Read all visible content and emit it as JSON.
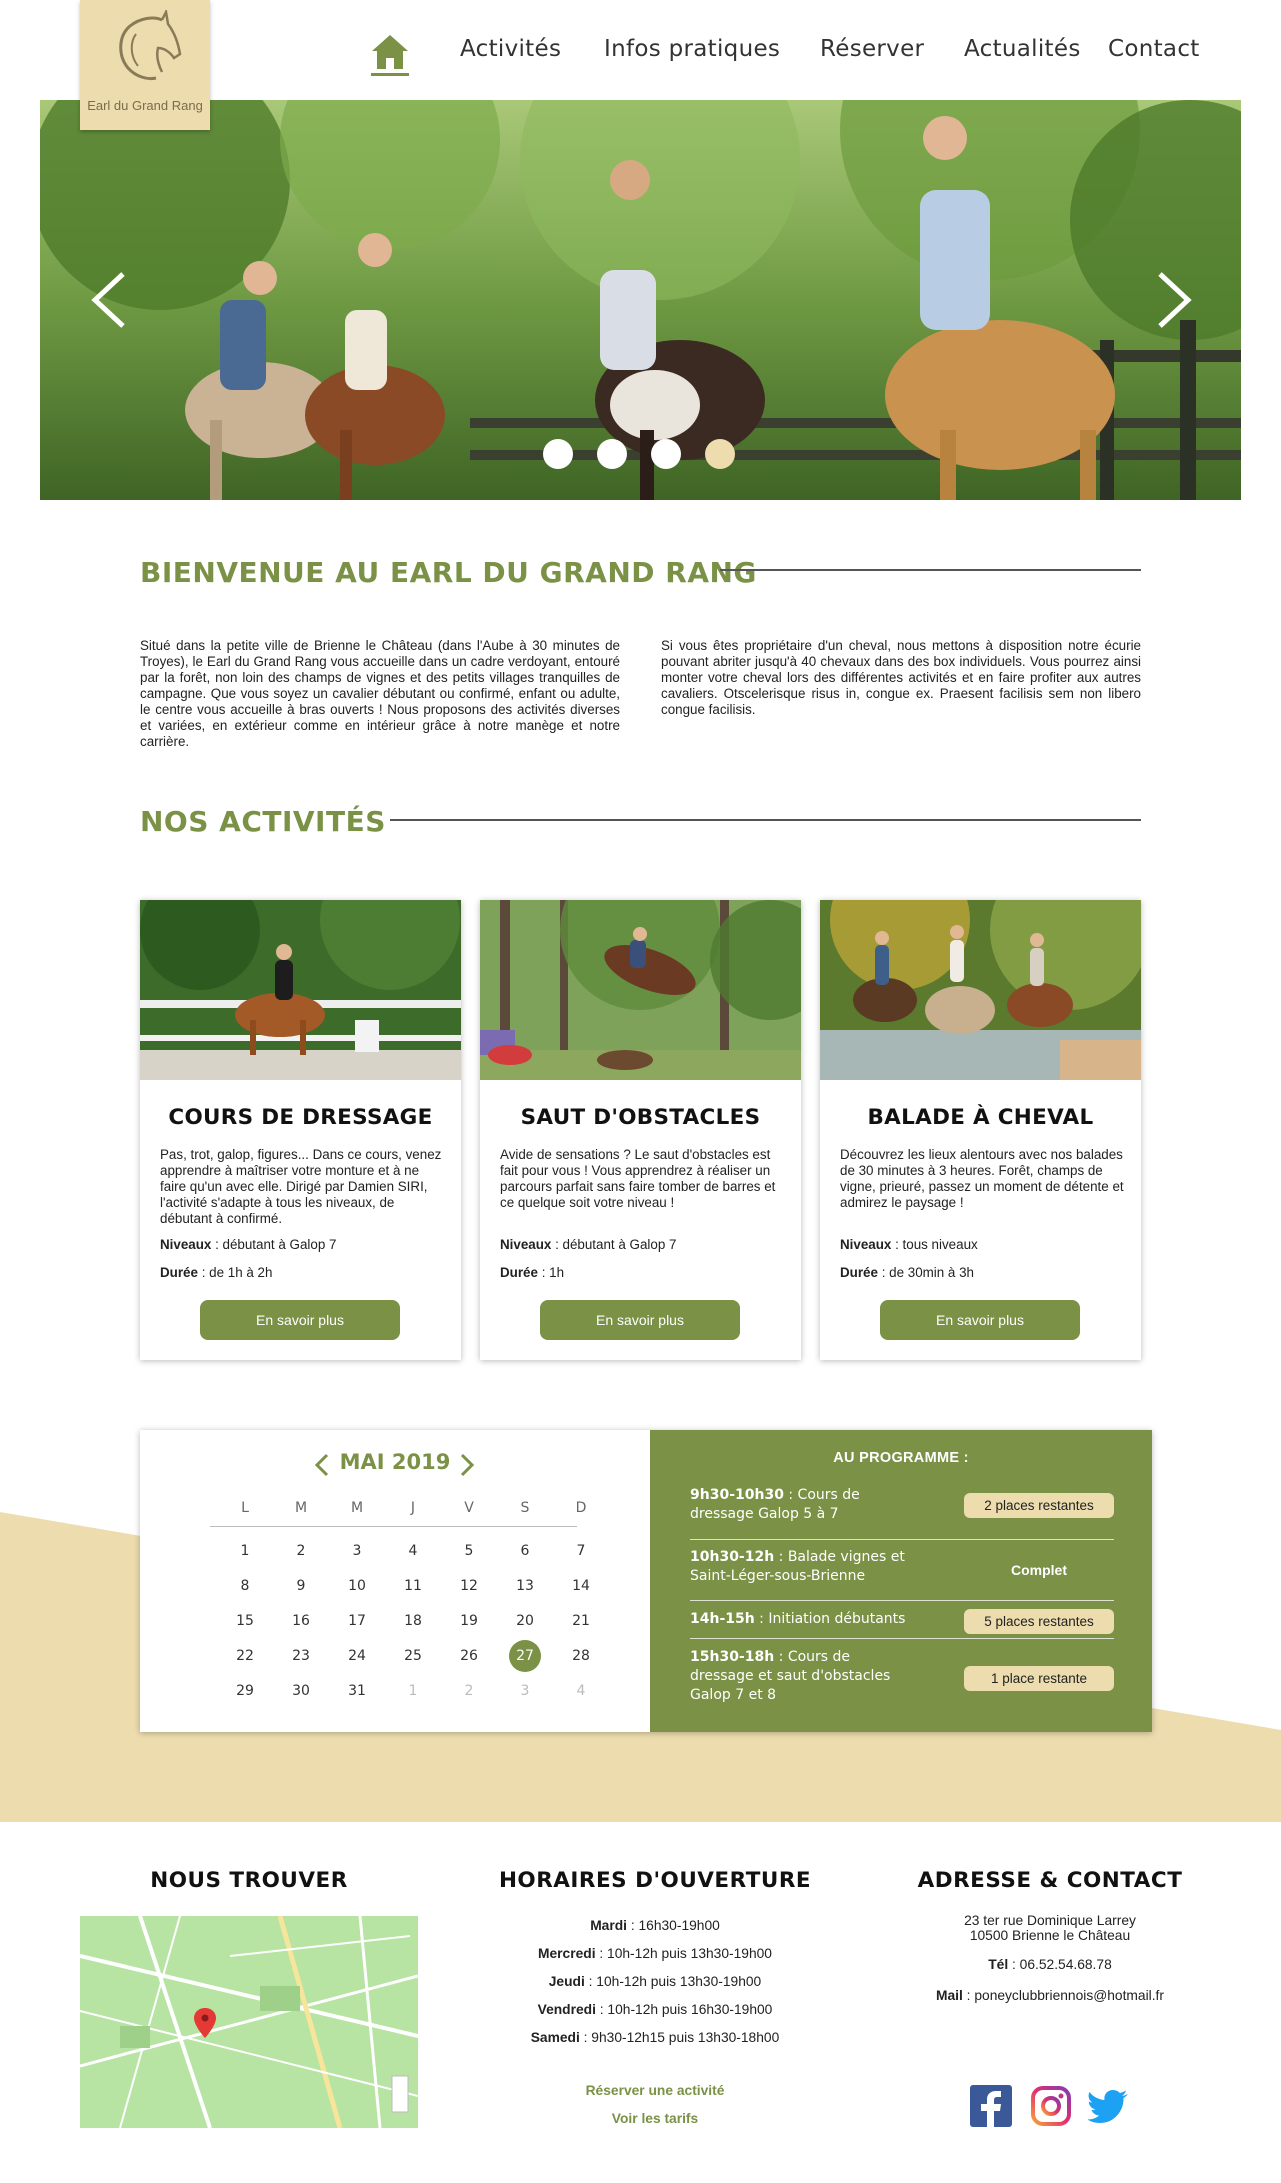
{
  "brand": {
    "logo_text": "Earl du Grand Rang"
  },
  "nav": {
    "home_icon": "home-icon",
    "items": [
      "Activités",
      "Infos pratiques",
      "Réserver",
      "Actualités",
      "Contact"
    ]
  },
  "slider": {
    "prev_icon": "chevron-left-icon",
    "next_icon": "chevron-right-icon",
    "slide_count": 4,
    "active_slide": 4
  },
  "welcome": {
    "title": "BIENVENUE AU EARL DU GRAND RANG",
    "col1": "Situé dans la petite ville de Brienne le Château (dans l'Aube à 30 minutes de Troyes), le Earl du Grand Rang vous accueille dans un cadre verdoyant, entouré par la forêt, non loin des champs de vignes et des petits villages tranquilles de campagne. Que vous soyez un cavalier débutant ou confirmé, enfant ou adulte, le centre vous accueille à bras ouverts ! Nous proposons des activités diverses et variées, en extérieur comme en intérieur grâce à notre manège et notre carrière.",
    "col2": "Si vous êtes propriétaire d'un cheval, nous mettons à disposition notre écurie pouvant abriter jusqu'à 40 chevaux dans des box individuels. Vous pourrez ainsi monter votre cheval lors des différentes activités et en faire profiter aux autres cavaliers. Otscelerisque risus in, congue ex. Praesent facilisis sem non libero congue facilisis."
  },
  "activities": {
    "title": "NOS ACTIVITÉS",
    "cards": [
      {
        "title": "COURS DE DRESSAGE",
        "description": "Pas, trot, galop, figures... Dans ce cours, venez apprendre à maîtriser votre monture et à ne faire qu'un avec elle. Dirigé par Damien SIRI, l'activité s'adapte à tous les niveaux, de débutant à confirmé.",
        "level_label": "Niveaux",
        "level": " : débutant à Galop 7",
        "duration_label": "Durée",
        "duration": " : de 1h à 2h",
        "button": "En savoir plus"
      },
      {
        "title": "SAUT D'OBSTACLES",
        "description": "Avide de sensations ? Le saut d'obstacles est fait pour vous ! Vous apprendrez à réaliser un parcours parfait sans faire tomber de barres et ce quelque soit votre niveau !",
        "level_label": "Niveaux",
        "level": " : débutant à Galop 7",
        "duration_label": "Durée",
        "duration": " : 1h",
        "button": "En savoir plus"
      },
      {
        "title": "BALADE À CHEVAL",
        "description": "Découvrez les lieux alentours avec nos balades de 30 minutes à 3 heures. Forêt, champs de vigne, prieuré, passez un moment de détente et admirez le paysage !",
        "level_label": "Niveaux",
        "level": " : tous niveaux",
        "duration_label": "Durée",
        "duration": " : de 30min à 3h",
        "button": "En savoir plus"
      }
    ]
  },
  "calendar": {
    "month": "MAI 2019",
    "weekdays": [
      "L",
      "M",
      "M",
      "J",
      "V",
      "S",
      "D"
    ],
    "weeks": [
      [
        "1",
        "2",
        "3",
        "4",
        "5",
        "6",
        "7"
      ],
      [
        "8",
        "9",
        "10",
        "11",
        "12",
        "13",
        "14"
      ],
      [
        "15",
        "16",
        "17",
        "18",
        "19",
        "20",
        "21"
      ],
      [
        "22",
        "23",
        "24",
        "25",
        "26",
        "27",
        "28"
      ],
      [
        "29",
        "30",
        "31",
        "1",
        "2",
        "3",
        "4"
      ]
    ],
    "today": "27",
    "muted_trailing_days": 4
  },
  "programme": {
    "title": "AU PROGRAMME :",
    "items": [
      {
        "time": "9h30-10h30",
        "text": " : Cours de dressage Galop 5 à 7",
        "status": "2 places restantes",
        "full": false
      },
      {
        "time": "10h30-12h",
        "text": " : Balade vignes et Saint-Léger-sous-Brienne",
        "status": "Complet",
        "full": true
      },
      {
        "time": "14h-15h",
        "text": " : Initiation débutants",
        "status": "5 places restantes",
        "full": false
      },
      {
        "time": "15h30-18h",
        "text": " : Cours de dressage et saut d'obstacles Galop 7 et 8",
        "status": "1 place restante",
        "full": false
      }
    ]
  },
  "footer": {
    "find_title": "NOUS TROUVER",
    "hours_title": "HORAIRES D'OUVERTURE",
    "contact_title": "ADRESSE & CONTACT",
    "hours": [
      {
        "day": "Mardi",
        "time": " : 16h30-19h00"
      },
      {
        "day": "Mercredi",
        "time": " : 10h-12h puis 13h30-19h00"
      },
      {
        "day": "Jeudi",
        "time": " : 10h-12h puis 13h30-19h00"
      },
      {
        "day": "Vendredi",
        "time": " : 10h-12h puis 16h30-19h00"
      },
      {
        "day": "Samedi",
        "time": " : 9h30-12h15 puis 13h30-18h00"
      }
    ],
    "link_book": "Réserver une activité",
    "link_prices": "Voir les tarifs",
    "address_line1": "23 ter rue Dominique Larrey",
    "address_line2": "10500 Brienne le Château",
    "phone_label": "Tél",
    "phone": " : 06.52.54.68.78",
    "mail_label": "Mail",
    "mail": " : poneyclubbriennois@hotmail.fr",
    "social": [
      "facebook-icon",
      "instagram-icon",
      "twitter-icon"
    ]
  },
  "colors": {
    "accent_green": "#7a9146",
    "beige": "#ecdcae"
  }
}
